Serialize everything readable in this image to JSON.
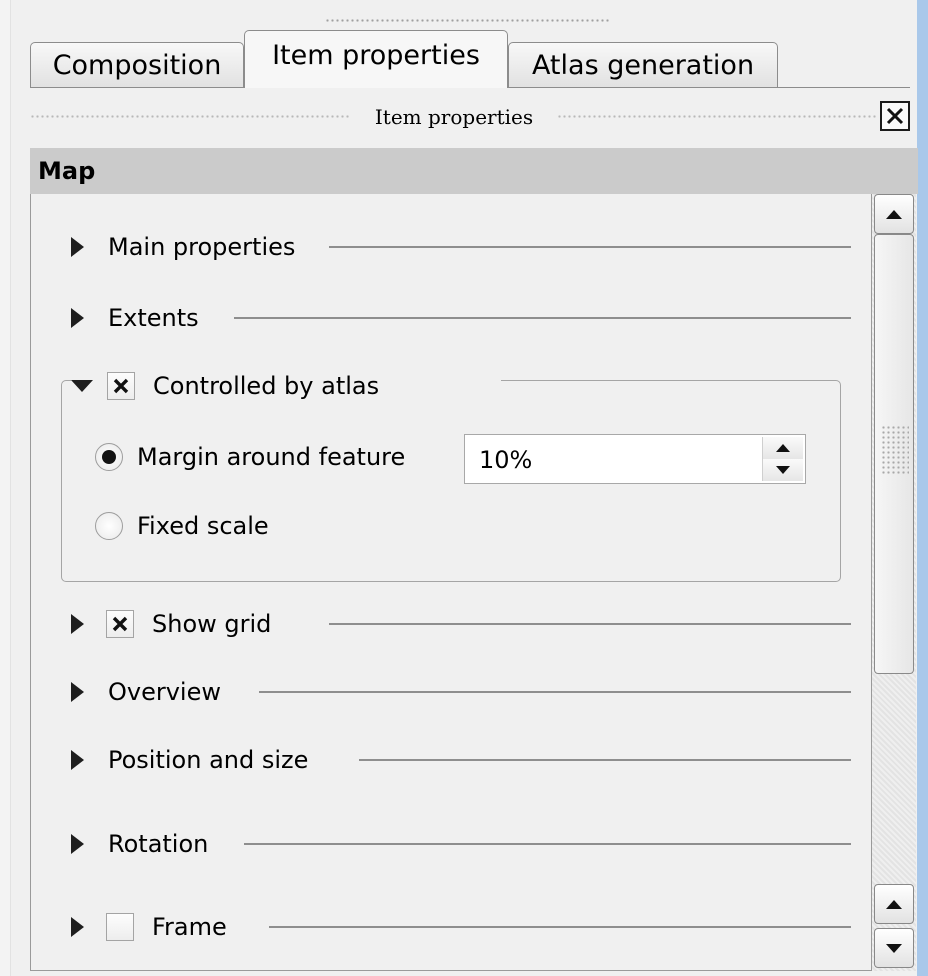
{
  "tabs": [
    {
      "label": "Composition",
      "active": false
    },
    {
      "label": "Item properties",
      "active": true
    },
    {
      "label": "Atlas generation",
      "active": false
    }
  ],
  "dock": {
    "title": "Item properties",
    "close_icon": "close-icon"
  },
  "section": {
    "title": "Map"
  },
  "groups": {
    "main_properties": {
      "label": "Main properties",
      "expanded": false
    },
    "extents": {
      "label": "Extents",
      "expanded": false
    },
    "controlled_by_atlas": {
      "label": "Controlled by atlas",
      "expanded": true,
      "checked": true
    },
    "show_grid": {
      "label": "Show grid",
      "expanded": false,
      "checked": true
    },
    "overview": {
      "label": "Overview",
      "expanded": false
    },
    "position_and_size": {
      "label": "Position and size",
      "expanded": false
    },
    "rotation": {
      "label": "Rotation",
      "expanded": false
    },
    "frame": {
      "label": "Frame",
      "expanded": false,
      "checked": false
    }
  },
  "atlas": {
    "margin_label": "Margin around feature",
    "margin_selected": true,
    "margin_value": "10%",
    "fixed_scale_label": "Fixed scale",
    "fixed_scale_selected": false
  },
  "colors": {
    "accent_strip": "#a9c8ea",
    "section_header_bg": "#cbcbcb"
  }
}
